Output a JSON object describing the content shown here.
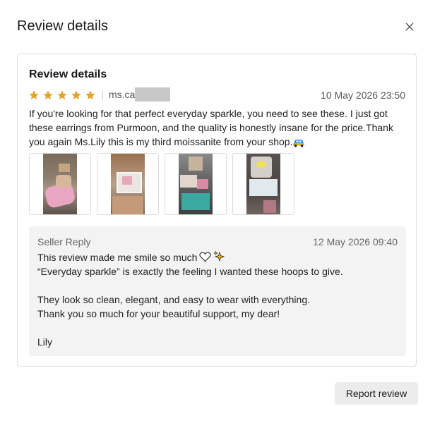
{
  "dialog": {
    "title": "Review details",
    "close_icon": "close-icon"
  },
  "review": {
    "card_title": "Review details",
    "rating": 5,
    "max_rating": 5,
    "star_color": "#e2a52b",
    "reviewer_visible": "ms.ca",
    "date": "10 May 2026 23:50",
    "text": "If you're looking for that perfect everyday sparkle, you need to see these. I just got these earrings from Purmoon, and the quality is honestly insane for the price.Thank you again Ms.Lily this is my third moissanite from your shop.",
    "text_emoji": "car-emoji",
    "photos": [
      {
        "name": "review-photo-1"
      },
      {
        "name": "review-photo-2"
      },
      {
        "name": "review-photo-3"
      },
      {
        "name": "review-photo-4"
      }
    ]
  },
  "seller_reply": {
    "label": "Seller Reply",
    "date": "12 May 2026 09:40",
    "line1": "This review made me smile so much",
    "line1_emojis": [
      "white-heart-icon",
      "sparkles-icon"
    ],
    "line2": "“Everyday sparkle” is exactly the feeling I wanted these hoops to give.",
    "line3": "",
    "line4": "They look so clean, elegant, and easy to wear with everything.",
    "line5": "Thank you so much for your beautiful support, my dear!",
    "line6": "",
    "line7": "Lily"
  },
  "actions": {
    "report_label": "Report review"
  }
}
